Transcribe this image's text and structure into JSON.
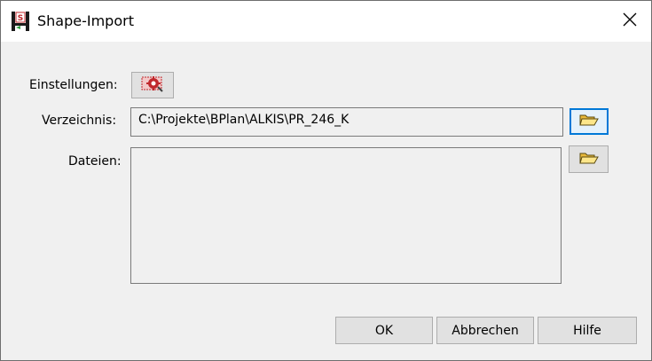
{
  "window": {
    "title": "Shape-Import",
    "app_icon": "hs-app-icon",
    "close_icon": "close-icon"
  },
  "form": {
    "settings_label": "Einstellungen:",
    "settings_icon": "settings-gear-icon",
    "directory_label": "Verzeichnis:",
    "directory_value": "C:\\Projekte\\BPlan\\ALKIS\\PR_246_K",
    "directory_browse_icon": "folder-open-icon",
    "files_label": "Dateien:",
    "files_items": [],
    "files_browse_icon": "folder-open-icon"
  },
  "buttons": {
    "ok": "OK",
    "cancel": "Abbrechen",
    "help": "Hilfe"
  },
  "colors": {
    "focus_border": "#0078d7",
    "folder_yellow": "#f5d23c"
  }
}
